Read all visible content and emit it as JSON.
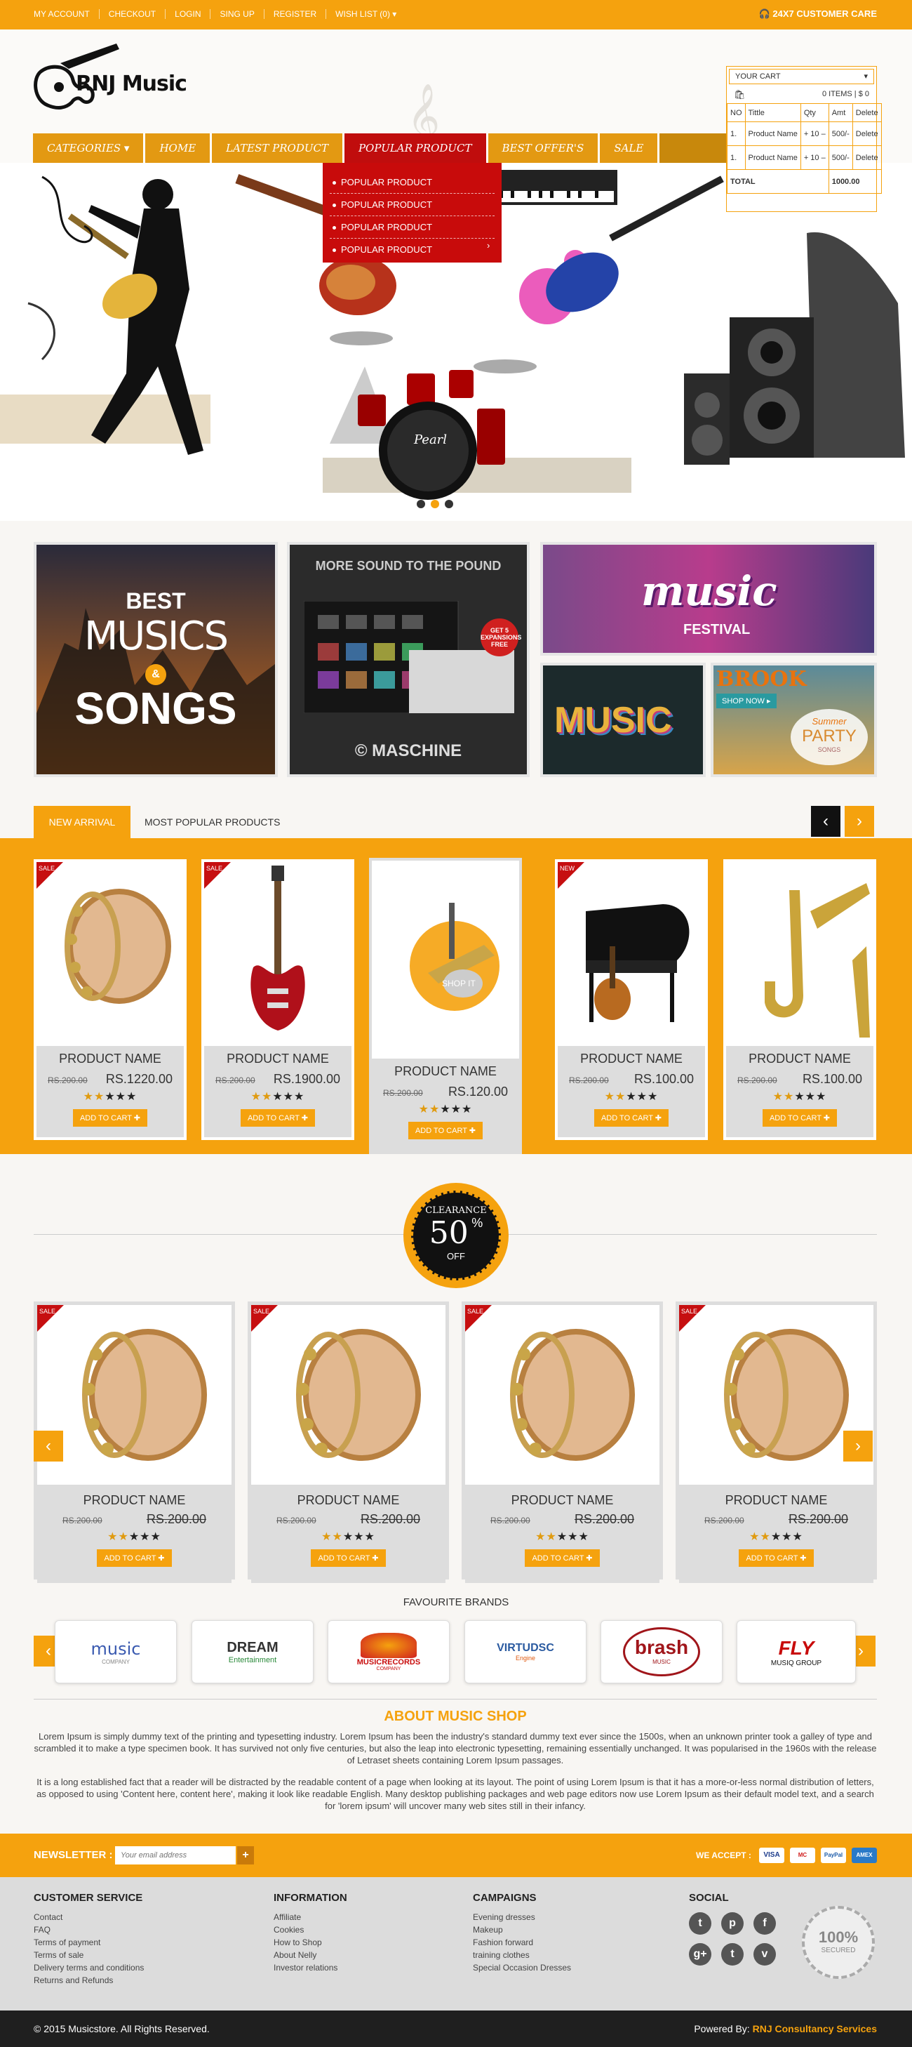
{
  "topbar": {
    "links": [
      "MY ACCOUNT",
      "CHECKOUT",
      "LOGIN",
      "SING UP",
      "REGISTER",
      "WISH LIST (0) ▾"
    ],
    "care": "24X7 CUSTOMER CARE"
  },
  "logo": {
    "text": "RNJ Music"
  },
  "nav": {
    "categories": "CATEGORIES ▾",
    "home": "HOME",
    "latest": "LATEST PRODUCT",
    "popular": "POPULAR PRODUCT",
    "best": "BEST OFFER'S",
    "sale": "SALE"
  },
  "dropdown": [
    "POPULAR PRODUCT",
    "POPULAR PRODUCT",
    "POPULAR PRODUCT",
    "POPULAR PRODUCT"
  ],
  "cart": {
    "label": "YOUR CART",
    "items": "0 ITEMS | $ 0",
    "headers": [
      "NO",
      "Tittle",
      "Qty",
      "Amt",
      "Delete"
    ],
    "rows": [
      {
        "no": "1.",
        "title": "Product Name",
        "qty": "+ 10 –",
        "amt": "500/-",
        "del": "Delete"
      },
      {
        "no": "1.",
        "title": "Product Name",
        "qty": "+ 10 –",
        "amt": "500/-",
        "del": "Delete"
      }
    ],
    "total_label": "TOTAL",
    "total": "1000.00"
  },
  "banner": {
    "drum_brand": "Pearl"
  },
  "promos": {
    "p1_best": "BEST",
    "p1_musics": "MUSICS",
    "p1_amp": "&",
    "p1_songs": "SONGS",
    "p2_title": "MORE SOUND TO THE POUND",
    "p2_brand": "© MASCHINE",
    "p2_badge": "GET 5 EXPANSIONS FREE",
    "p3_text": "music",
    "p3_sub": "FESTIVAL",
    "p4_text": "MUSIC",
    "p5_brand": "BROOK",
    "p5_shop": "SHOP NOW ▸",
    "p5_summer": "Summer",
    "p5_party": "PARTY",
    "p5_songs": "SONGS"
  },
  "tabs": {
    "new": "NEW ARRIVAL",
    "popular": "MOST POPULAR PRODUCTS"
  },
  "arrivals": [
    {
      "badge": "SALE",
      "name": "PRODUCT NAME",
      "old": "RS.200.00",
      "price": "RS.1220.00",
      "cart": "ADD TO CART",
      "icon": "tambourine-icon"
    },
    {
      "badge": "SALE",
      "name": "PRODUCT NAME",
      "old": "RS.200.00",
      "price": "RS.1900.00",
      "cart": "ADD TO CART",
      "icon": "electric-guitar-icon"
    },
    {
      "badge": "",
      "name": "PRODUCT NAME",
      "old": "RS.200.00",
      "price": "RS.120.00",
      "cart": "ADD TO CART",
      "icon": "instruments-icon",
      "overlay": "SHOP IT"
    },
    {
      "badge": "NEW",
      "name": "PRODUCT NAME",
      "old": "RS.200.00",
      "price": "RS.100.00",
      "cart": "ADD TO CART",
      "icon": "piano-icon"
    },
    {
      "badge": "",
      "name": "PRODUCT NAME",
      "old": "RS.200.00",
      "price": "RS.100.00",
      "cart": "ADD TO CART",
      "icon": "saxophone-icon"
    }
  ],
  "clearance": {
    "line1": "CLEARANCE",
    "num": "50",
    "pct": "%",
    "off": "OFF"
  },
  "featured": [
    {
      "badge": "SALE",
      "name": "PRODUCT NAME",
      "old": "RS.200.00",
      "price": "RS.200.00",
      "cart": "ADD TO CART"
    },
    {
      "badge": "SALE",
      "name": "PRODUCT NAME",
      "old": "RS.200.00",
      "price": "RS.200.00",
      "cart": "ADD TO CART"
    },
    {
      "badge": "SALE",
      "name": "PRODUCT NAME",
      "old": "RS.200.00",
      "price": "RS.200.00",
      "cart": "ADD TO CART"
    },
    {
      "badge": "SALE",
      "name": "PRODUCT NAME",
      "old": "RS.200.00",
      "price": "RS.200.00",
      "cart": "ADD TO CART"
    }
  ],
  "brands": {
    "title": "FAVOURITE BRANDS",
    "items": [
      {
        "name": "music",
        "sub": "COMPANY"
      },
      {
        "name": "DREAM",
        "sub": "Entertainment"
      },
      {
        "name": "MUSICRECORDS",
        "sub": "COMPANY"
      },
      {
        "name": "VIRTUDSC",
        "sub": "Engine"
      },
      {
        "name": "brash",
        "sub": "MUSIC"
      },
      {
        "name": "FLY",
        "sub": "MUSIQ GROUP"
      }
    ]
  },
  "about": {
    "title": "ABOUT MUSIC SHOP",
    "p1": "Lorem Ipsum is simply dummy text of the printing and typesetting industry. Lorem Ipsum has been the industry's standard dummy text ever since the 1500s, when an unknown printer took a galley of type and scrambled it to make a type specimen book. It has survived not only five centuries, but also the leap into electronic typesetting, remaining essentially unchanged. It was popularised in the 1960s with the release of Letraset sheets containing Lorem Ipsum passages.",
    "p2": "It is a long established fact that a reader will be distracted by the readable content of a page when looking at its layout. The point of using Lorem Ipsum is that it has a more-or-less normal distribution of letters, as opposed to using 'Content here, content here', making it look like readable English. Many desktop publishing packages and web page editors now use Lorem Ipsum as their default model text, and a search for 'lorem ipsum' will uncover many web sites still in their infancy."
  },
  "newsletter": {
    "label": "NEWSLETTER :",
    "placeholder": "Your email address",
    "submit": "+",
    "accept": "WE ACCEPT :",
    "cards": [
      "VISA",
      "MC",
      "PayPal",
      "AMEX"
    ]
  },
  "footer": {
    "customer": {
      "title": "CUSTOMER SERVICE",
      "links": [
        "Contact",
        "FAQ",
        "Terms of payment",
        "Terms of sale",
        "Delivery terms and conditions",
        "Returns and Refunds"
      ]
    },
    "info": {
      "title": "INFORMATION",
      "links": [
        "Affiliate",
        "Cookies",
        "How to Shop",
        "About Nelly",
        "Investor relations"
      ]
    },
    "camp": {
      "title": "CAMPAIGNS",
      "links": [
        "Evening dresses",
        "Makeup",
        "Fashion forward",
        "training clothes",
        "Special Occasion Dresses"
      ]
    },
    "social": {
      "title": "SOCIAL",
      "icons": [
        "t",
        "p",
        "f",
        "g+",
        "t",
        "v"
      ]
    },
    "secured": {
      "pct": "100%",
      "label": "SECURED"
    }
  },
  "bottom": {
    "copy": "© 2015 Musicstore. All Rights Reserved.",
    "powered": "Powered By:",
    "by": "RNJ Consultancy Services"
  },
  "colors": {
    "orange": "#f5a20e",
    "red": "#c80b0b",
    "dark": "#1f1f1f"
  }
}
